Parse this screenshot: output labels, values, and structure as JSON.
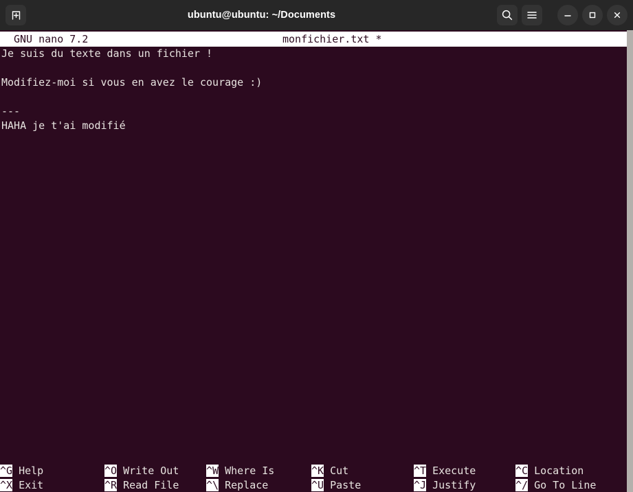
{
  "window": {
    "titlebar": {
      "title": "ubuntu@ubuntu: ~/Documents",
      "new_tab_icon": "new-tab-icon",
      "search_icon": "search-icon",
      "menu_icon": "hamburger-menu-icon",
      "minimize_icon": "minimize-icon",
      "maximize_icon": "maximize-icon",
      "close_icon": "close-icon"
    },
    "background_color": "#2c0a1f",
    "titlebar_color": "#272727",
    "scrollbar_color": "#b4b0ac",
    "inverse_bg": "#ffffff",
    "text_color": "#e8e4e0"
  },
  "nano": {
    "version": "GNU nano 7.2",
    "filename": "monfichier.txt *",
    "lines": [
      "Je suis du texte dans un fichier !",
      "",
      "Modifiez-moi si vous en avez le courage :)",
      "",
      "---",
      "HAHA je t'ai modifié"
    ],
    "shortcuts": [
      {
        "key": "^G",
        "label": "Help",
        "row": 1,
        "col": 1
      },
      {
        "key": "^O",
        "label": "Write Out",
        "row": 1,
        "col": 2
      },
      {
        "key": "^W",
        "label": "Where Is",
        "row": 1,
        "col": 3
      },
      {
        "key": "^K",
        "label": "Cut",
        "row": 1,
        "col": 4
      },
      {
        "key": "^T",
        "label": "Execute",
        "row": 1,
        "col": 5
      },
      {
        "key": "^C",
        "label": "Location",
        "row": 1,
        "col": 6
      },
      {
        "key": "^X",
        "label": "Exit",
        "row": 2,
        "col": 1
      },
      {
        "key": "^R",
        "label": "Read File",
        "row": 2,
        "col": 2
      },
      {
        "key": "^\\",
        "label": "Replace",
        "row": 2,
        "col": 3
      },
      {
        "key": "^U",
        "label": "Paste",
        "row": 2,
        "col": 4
      },
      {
        "key": "^J",
        "label": "Justify",
        "row": 2,
        "col": 5
      },
      {
        "key": "^/",
        "label": "Go To Line",
        "row": 2,
        "col": 6
      }
    ]
  }
}
